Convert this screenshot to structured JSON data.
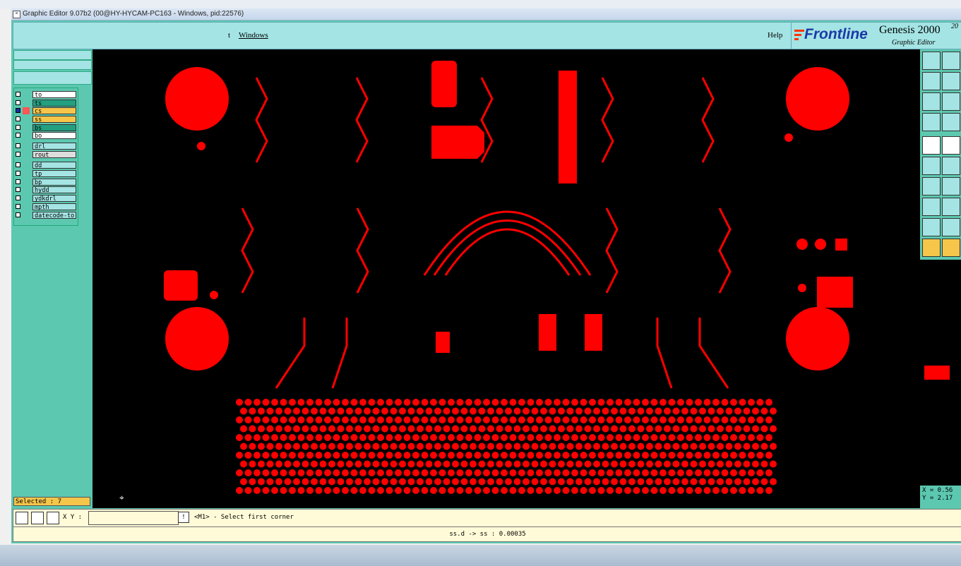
{
  "window": {
    "title": "Graphic Editor 9.07b2 (00@HY-HYCAM-PC163 - Windows, pid:22576)"
  },
  "menubar": {
    "partial_item": "t",
    "windows_label": "Windows",
    "help_label": "Help"
  },
  "brand": {
    "logo_text": "Frontline",
    "product": "Genesis 2000",
    "subtitle": "Graphic Editor",
    "superscript": "20"
  },
  "layers": [
    {
      "name": "to",
      "color": "#ffffff",
      "affected": false
    },
    {
      "name": "ts",
      "color": "#22a080",
      "affected": false
    },
    {
      "name": "cs",
      "color": "#f6c64a",
      "affected": true
    },
    {
      "name": "ss",
      "color": "#f6c64a",
      "affected": false
    },
    {
      "name": "bs",
      "color": "#22a080",
      "affected": false
    },
    {
      "name": "bo",
      "color": "#ffffff",
      "affected": false
    },
    {
      "name": "drl",
      "color": "#a4e4e4",
      "affected": false
    },
    {
      "name": "rout",
      "color": "#dddddd",
      "affected": false
    },
    {
      "name": "dd",
      "color": "#a4e4e4",
      "affected": false
    },
    {
      "name": "tp",
      "color": "#a4e4e4",
      "affected": false
    },
    {
      "name": "bp",
      "color": "#a4e4e4",
      "affected": false
    },
    {
      "name": "hydd",
      "color": "#a4e4e4",
      "affected": false
    },
    {
      "name": "ydkdrl",
      "color": "#a4e4e4",
      "affected": false
    },
    {
      "name": "mpth",
      "color": "#a4e4e4",
      "affected": false
    },
    {
      "name": "datecode-to",
      "color": "#a4e4e4",
      "affected": false
    }
  ],
  "selected": "Selected : 7",
  "coords": {
    "x": "X = 0.56",
    "y": "Y = 2.17"
  },
  "bottombar": {
    "xy_label": "X Y :",
    "xy_value": "",
    "prompt": "<M1> - Select first corner"
  },
  "status": "ss.d -> ss : 0.00035",
  "colors": {
    "pcb_red": "#ff0000",
    "canvas_bg": "#000000",
    "panel_teal": "#5cc8b0",
    "light_cyan": "#a4e4e4",
    "highlight_yellow": "#f6c64a"
  }
}
